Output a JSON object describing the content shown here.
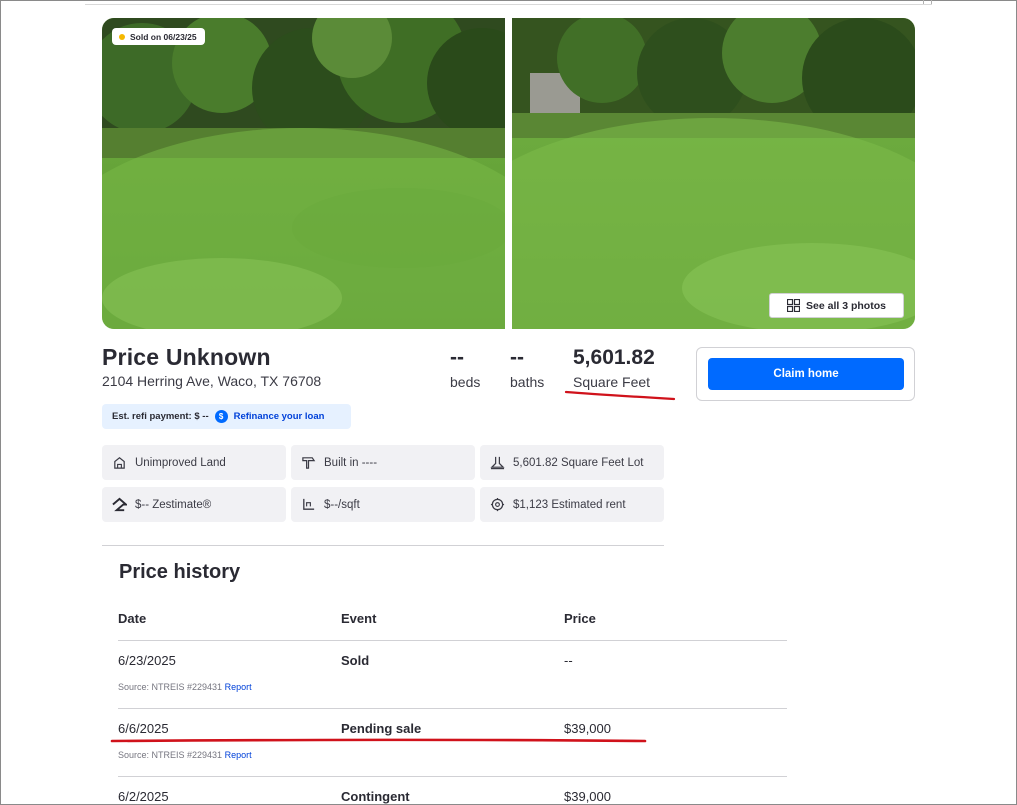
{
  "photos": {
    "sold_badge": "Sold on 06/23/25",
    "see_all": "See all 3 photos"
  },
  "summary": {
    "price": "Price Unknown",
    "address": "2104 Herring Ave, Waco, TX 76708",
    "beds_value": "--",
    "beds_label": "beds",
    "baths_value": "--",
    "baths_label": "baths",
    "sqft_value": "5,601.82",
    "sqft_label": "Square Feet"
  },
  "claim": {
    "button": "Claim home"
  },
  "refi": {
    "label": "Est. refi payment: $ --",
    "link": "Refinance your loan"
  },
  "facts": [
    {
      "label": "Unimproved Land",
      "icon": "land-icon"
    },
    {
      "label": "Built in ----",
      "icon": "hammer-icon"
    },
    {
      "label": "5,601.82 Square Feet Lot",
      "icon": "lot-size-icon"
    },
    {
      "label": "$-- Zestimate®",
      "icon": "zestimate-home-icon"
    },
    {
      "label": "$--/sqft",
      "icon": "price-per-sqft-icon"
    },
    {
      "label": "$1,123 Estimated rent",
      "icon": "rent-icon"
    }
  ],
  "price_history": {
    "title": "Price history",
    "headers": [
      "Date",
      "Event",
      "Price"
    ],
    "rows": [
      {
        "date": "6/23/2025",
        "event": "Sold",
        "price": "--",
        "source": "Source: NTREIS #229431",
        "report": "Report"
      },
      {
        "date": "6/6/2025",
        "event": "Pending sale",
        "price": "$39,000",
        "source": "Source: NTREIS #229431",
        "report": "Report"
      },
      {
        "date": "6/2/2025",
        "event": "Contingent",
        "price": "$39,000"
      }
    ]
  },
  "colors": {
    "accent": "#006aff",
    "link": "#0041d9",
    "annotation": "#d0121b",
    "fact_bg": "#f1f1f4",
    "refi_bg": "#e6f1ff"
  }
}
